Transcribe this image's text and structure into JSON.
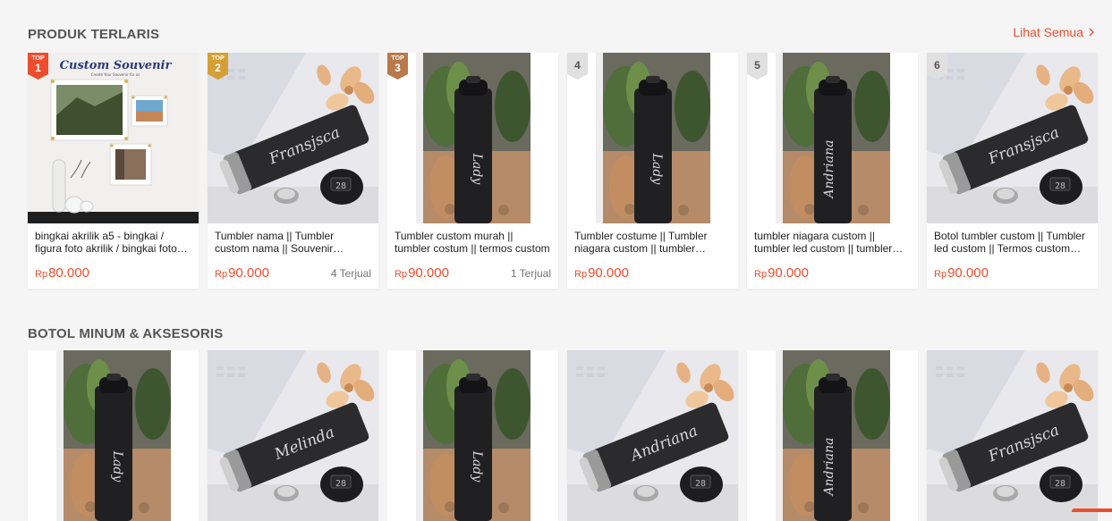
{
  "section1": {
    "title": "PRODUK TERLARIS",
    "see_all": "Lihat Semua",
    "products": [
      {
        "badge_top": "TOP",
        "rank": "1",
        "badge_color": "#ee4d2d",
        "image": "acrylic-frame-photo",
        "name": "bingkai akrilik a5 - bingkai / figura foto akrilik / bingkai foto akrilik",
        "currency": "Rp",
        "price": "80.000",
        "sold": ""
      },
      {
        "badge_top": "TOP",
        "rank": "2",
        "badge_color": "#d4a035",
        "image": "black-tumbler-lying-franjisca",
        "name": "Tumbler nama || Tumbler custom nama || Souvenir tumbler custom",
        "currency": "Rp",
        "price": "90.000",
        "sold": "4 Terjual"
      },
      {
        "badge_top": "TOP",
        "rank": "3",
        "badge_color": "#b87a4a",
        "image": "black-tumbler-standing-lady",
        "name": "Tumbler custom murah || tumbler costum || termos custom",
        "currency": "Rp",
        "price": "90.000",
        "sold": "1 Terjual"
      },
      {
        "badge_top": "",
        "rank": "4",
        "badge_color": "#e0e0e0",
        "image": "black-tumbler-standing-lady",
        "name": "Tumbler costume || Tumbler niagara custom || tumbler custom",
        "currency": "Rp",
        "price": "90.000",
        "sold": ""
      },
      {
        "badge_top": "",
        "rank": "5",
        "badge_color": "#e0e0e0",
        "image": "black-tumbler-standing-andriana",
        "name": "tumbler niagara custom || tumbler led custom || tumbler custom",
        "currency": "Rp",
        "price": "90.000",
        "sold": ""
      },
      {
        "badge_top": "",
        "rank": "6",
        "badge_color": "#e0e0e0",
        "image": "black-tumbler-lying-franjisca",
        "name": "Botol tumbler custom || Tumbler led custom || Termos custom nama",
        "currency": "Rp",
        "price": "90.000",
        "sold": ""
      }
    ]
  },
  "section2": {
    "title": "BOTOL MINUM & AKSESORIS",
    "products": [
      {
        "image": "black-tumbler-standing-lady"
      },
      {
        "image": "black-tumbler-lying-melinda"
      },
      {
        "image": "black-tumbler-standing-lady"
      },
      {
        "image": "black-tumbler-lying-andriana"
      },
      {
        "image": "black-tumbler-standing-andriana"
      },
      {
        "image": "black-tumbler-lying-franjisca"
      }
    ]
  },
  "colors": {
    "accent": "#ee4d2d",
    "background": "#f5f5f5"
  },
  "image_text": {
    "frame_logo": "Custom Souvenir",
    "frame_tagline": "Create Your Souvenir for us",
    "led_display": "28",
    "engrave_franjisca": "Fransjsca",
    "engrave_melinda": "Melinda",
    "engrave_andriana": "Andriana",
    "engrave_lady": "Lady"
  }
}
